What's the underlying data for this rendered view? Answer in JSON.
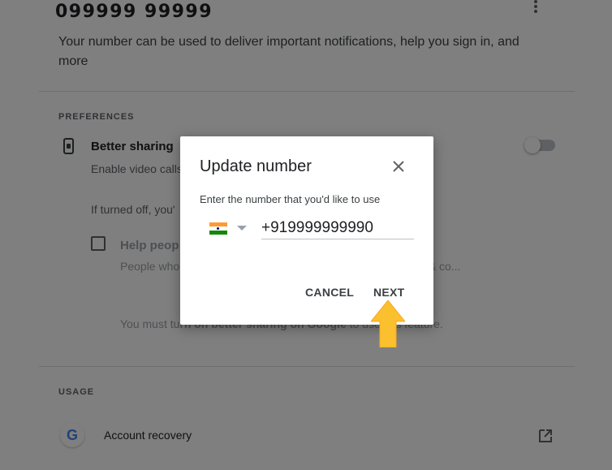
{
  "account": {
    "phone": "099999  99999",
    "description": "Your number can be used to deliver important notifications, help you sign in, and more"
  },
  "preferences": {
    "section_label": "PREFERENCES",
    "better_sharing_title": "Better sharing",
    "better_sharing_body": "Enable video calls ... gle services when people send ...",
    "if_off_text": "If turned off, you'",
    "help_title": "Help peop",
    "help_body": "People who ... s, photo, and identify thi ... s reviews on Maps & co...",
    "help_note_prefix": "You must tu",
    "help_note_bold": "rn on better sharing on Google",
    "help_note_suffix": " to use this feature."
  },
  "usage": {
    "section_label": "USAGE",
    "account_recovery": "Account recovery",
    "icons": [
      "google-icon",
      "open-in-new-icon"
    ]
  },
  "dialog": {
    "title": "Update number",
    "prompt": "Enter the number that you'd like to use",
    "phone_value": "+919999999990",
    "country_flag": "india-flag-icon",
    "cancel_label": "CANCEL",
    "next_label": "NEXT",
    "highlight_color": "#fbc02d"
  }
}
